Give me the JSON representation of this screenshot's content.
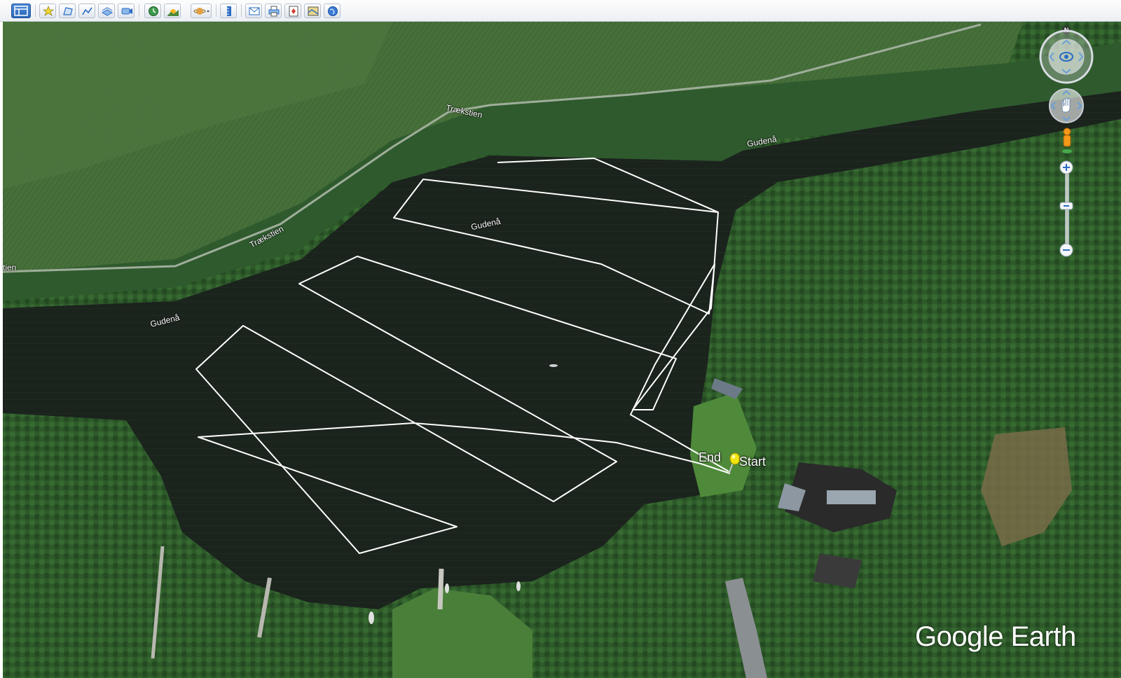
{
  "app": {
    "brand": "Google Earth"
  },
  "toolbar": {
    "buttons": [
      {
        "name": "sidebar-toggle",
        "icon": "sidebar-icon"
      },
      {
        "name": "add-placemark",
        "icon": "placemark-add-icon"
      },
      {
        "name": "add-polygon",
        "icon": "polygon-add-icon"
      },
      {
        "name": "add-path",
        "icon": "path-add-icon"
      },
      {
        "name": "add-image-overlay",
        "icon": "image-overlay-icon"
      },
      {
        "name": "record-tour",
        "icon": "record-tour-icon"
      },
      {
        "name": "historical-imagery",
        "icon": "clock-icon"
      },
      {
        "name": "sunlight",
        "icon": "sun-icon"
      },
      {
        "name": "switch-planet",
        "icon": "planet-icon"
      },
      {
        "name": "ruler",
        "icon": "ruler-icon"
      },
      {
        "name": "email",
        "icon": "email-icon"
      },
      {
        "name": "print",
        "icon": "print-icon"
      },
      {
        "name": "save-image",
        "icon": "save-image-icon"
      },
      {
        "name": "view-in-maps",
        "icon": "maps-icon"
      },
      {
        "name": "earth-gallery",
        "icon": "globe-icon"
      }
    ]
  },
  "map": {
    "labels": {
      "road_top": "Trækstien",
      "road_left": "Trækstien",
      "road_edge": "tien",
      "river_left": "Gudenå",
      "river_center": "Gudenå",
      "river_right": "Gudenå"
    },
    "placemark": {
      "start_label": "Start",
      "end_label": "End"
    }
  },
  "navigation": {
    "north_label": "N"
  },
  "colors": {
    "track": "#ffffff",
    "placemark": "#f2e40f",
    "toolbar_icon": "#2b6cc4"
  }
}
